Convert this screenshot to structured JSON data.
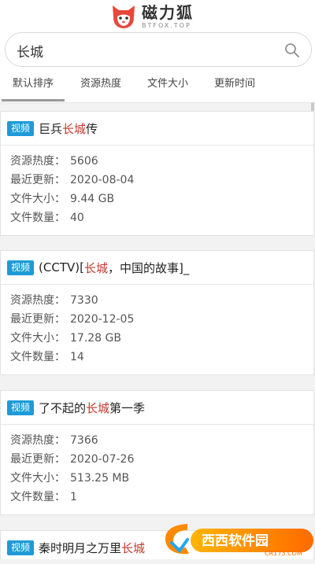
{
  "header": {
    "logo_cn": "磁力狐",
    "logo_en": "BTFOX.TOP"
  },
  "search": {
    "value": "长城"
  },
  "tabs": [
    {
      "label": "默认排序",
      "active": true
    },
    {
      "label": "资源热度",
      "active": false
    },
    {
      "label": "文件大小",
      "active": false
    },
    {
      "label": "更新时间",
      "active": false
    }
  ],
  "results": [
    {
      "badge": "视频",
      "title_pre": "巨兵",
      "title_hl": "长城",
      "title_post": "传",
      "heat_label": "资源热度：",
      "heat": "5606",
      "updated_label": "最近更新：",
      "updated": "2020-08-04",
      "size_label": "文件大小：",
      "size": "9.44 GB",
      "count_label": "文件数量：",
      "count": "40"
    },
    {
      "badge": "视频",
      "title_pre": "(CCTV)[",
      "title_hl": "长城",
      "title_post": "，中国的故事]_",
      "heat_label": "资源热度：",
      "heat": "7330",
      "updated_label": "最近更新：",
      "updated": "2020-12-05",
      "size_label": "文件大小：",
      "size": "17.28 GB",
      "count_label": "文件数量：",
      "count": "14"
    },
    {
      "badge": "视频",
      "title_pre": "了不起的",
      "title_hl": "长城",
      "title_post": "第一季",
      "heat_label": "资源热度：",
      "heat": "7366",
      "updated_label": "最近更新：",
      "updated": "2020-07-26",
      "size_label": "文件大小：",
      "size": "513.25 MB",
      "count_label": "文件数量：",
      "count": "1"
    },
    {
      "badge": "视频",
      "title_pre": "秦时明月之万里",
      "title_hl": "长城",
      "title_post": ""
    }
  ],
  "watermark": {
    "text": "西西软件园",
    "url": "CR173.COM"
  },
  "colors": {
    "badge": "#1e9bd7",
    "highlight": "#c0392b",
    "logo_red": "#e8473c"
  }
}
